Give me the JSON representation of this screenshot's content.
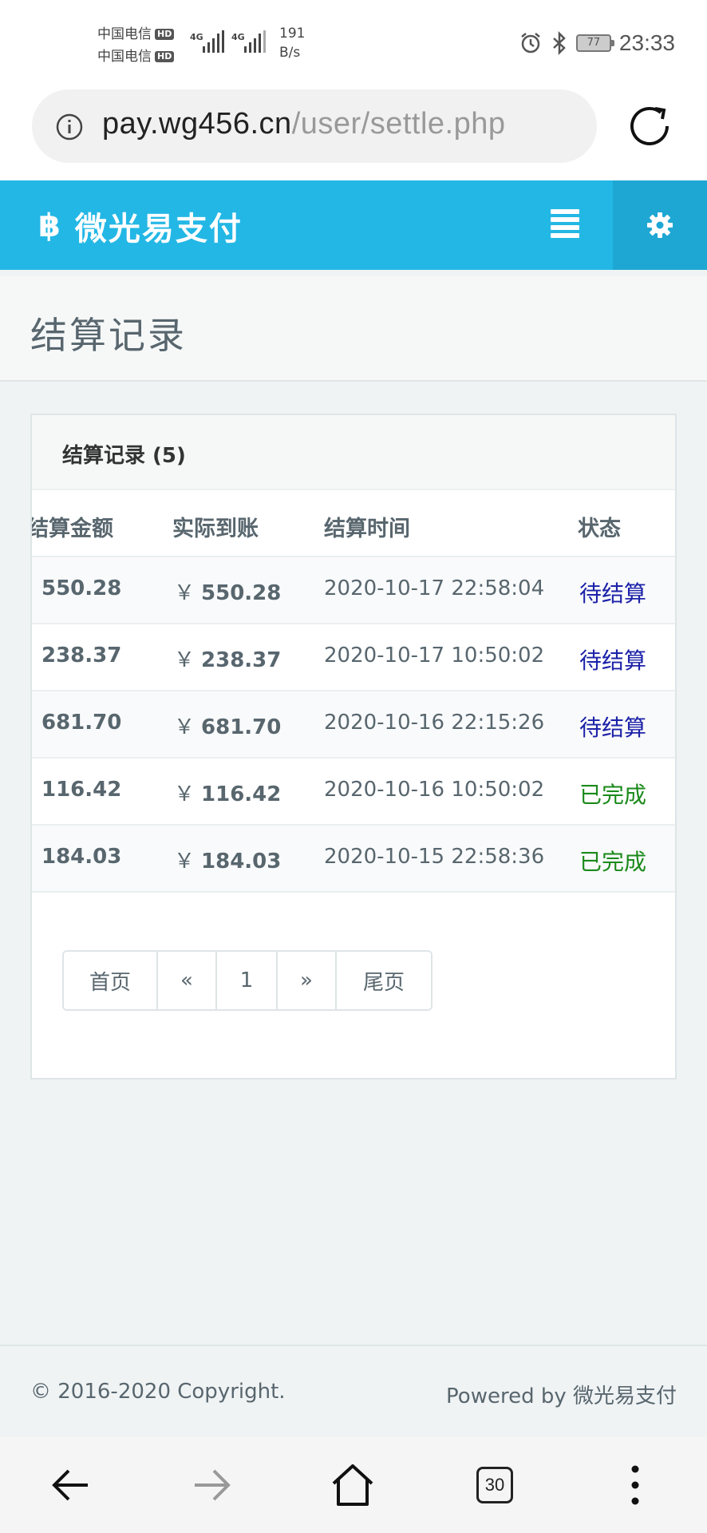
{
  "status_bar": {
    "carrier1": "中国电信",
    "carrier2": "中国电信",
    "hd_badge": "HD",
    "net_speed_value": "191",
    "net_speed_unit": "B/s",
    "battery": "77",
    "time": "23:33",
    "signal_label": "4G"
  },
  "browser": {
    "url_host": "pay.wg456.cn",
    "url_path": "/user/settle.php",
    "tabs_count": "30"
  },
  "header": {
    "brand_icon": "฿",
    "brand_name": "微光易支付"
  },
  "page": {
    "title": "结算记录"
  },
  "panel": {
    "title": "结算记录 (5)",
    "columns": {
      "amount": "结算金额",
      "real": "实际到账",
      "time": "结算时间",
      "status": "状态"
    },
    "currency_symbol": "￥",
    "rows": [
      {
        "amount": "550.28",
        "real": "550.28",
        "time": "2020-10-17 22:58:04",
        "status": "待结算",
        "state": "pending"
      },
      {
        "amount": "238.37",
        "real": "238.37",
        "time": "2020-10-17 10:50:02",
        "status": "待结算",
        "state": "pending"
      },
      {
        "amount": "681.70",
        "real": "681.70",
        "time": "2020-10-16 22:15:26",
        "status": "待结算",
        "state": "pending"
      },
      {
        "amount": "116.42",
        "real": "116.42",
        "time": "2020-10-16 10:50:02",
        "status": "已完成",
        "state": "done"
      },
      {
        "amount": "184.03",
        "real": "184.03",
        "time": "2020-10-15 22:58:36",
        "status": "已完成",
        "state": "done"
      }
    ],
    "pagination": {
      "first": "首页",
      "prev": "«",
      "current": "1",
      "next": "»",
      "last": "尾页"
    }
  },
  "footer": {
    "copyright": "© 2016-2020 Copyright.",
    "powered": "Powered by 微光易支付"
  },
  "colors": {
    "brand": "#23b7e5",
    "pending": "#1c22a8",
    "done": "#1b8a1b"
  }
}
